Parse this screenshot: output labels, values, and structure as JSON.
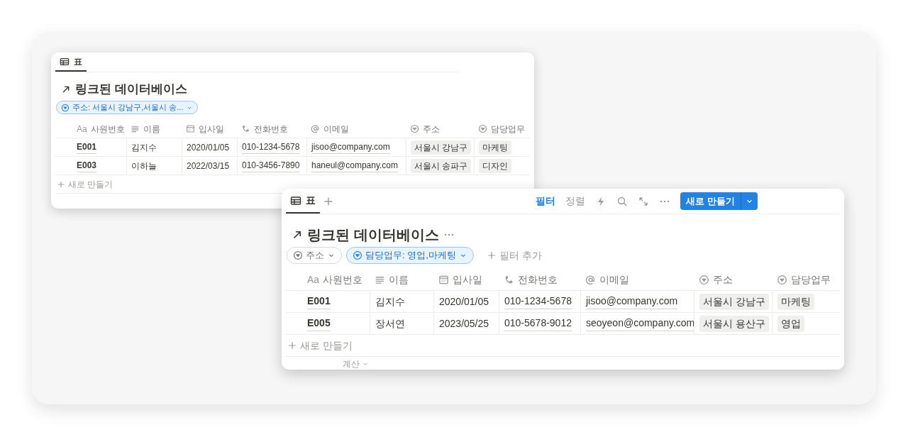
{
  "views": [
    {
      "tabs": [
        {
          "label": "표",
          "selected": true
        }
      ],
      "title": "링크된 데이터베이스",
      "filters": [
        {
          "label": "주소: 서울시 강남구,서울시 송...",
          "selected": true
        }
      ],
      "columns": [
        {
          "kind": "title",
          "icon_text": "Aa",
          "label": "사원번호"
        },
        {
          "kind": "text",
          "label": "이름"
        },
        {
          "kind": "date",
          "label": "입사일"
        },
        {
          "kind": "phone",
          "label": "전화번호"
        },
        {
          "kind": "email",
          "label": "이메일"
        },
        {
          "kind": "select",
          "label": "주소"
        },
        {
          "kind": "select",
          "label": "담당업무"
        }
      ],
      "rows": [
        [
          "E001",
          "김지수",
          "2020/01/05",
          "010-1234-5678",
          "jisoo@company.com",
          "서울시 강남구",
          "마케팅"
        ],
        [
          "E003",
          "이하늘",
          "2022/03/15",
          "010-3456-7890",
          "haneul@company.com",
          "서울시 송파구",
          "디자인"
        ]
      ],
      "new_row": "새로 만들기"
    },
    {
      "tabs": [
        {
          "label": "표",
          "selected": true
        }
      ],
      "add_tab": true,
      "title": "링크된 데이터베이스",
      "more_menu": true,
      "filters": [
        {
          "label": "주소",
          "selected": false
        },
        {
          "label": "담당업무: 영업,마케팅",
          "selected": true
        }
      ],
      "add_filter": "필터 추가",
      "toolbar": {
        "filter": {
          "label": "필터",
          "selected": true
        },
        "sort": {
          "label": "정렬",
          "selected": false
        },
        "new_button": "새로 만들기"
      },
      "columns": [
        {
          "kind": "title",
          "icon_text": "Aa",
          "label": "사원번호"
        },
        {
          "kind": "text",
          "label": "이름"
        },
        {
          "kind": "date",
          "label": "입사일"
        },
        {
          "kind": "phone",
          "label": "전화번호"
        },
        {
          "kind": "email",
          "label": "이메일"
        },
        {
          "kind": "select",
          "label": "주소"
        },
        {
          "kind": "select",
          "label": "담당업무"
        }
      ],
      "rows": [
        [
          "E001",
          "김지수",
          "2020/01/05",
          "010-1234-5678",
          "jisoo@company.com",
          "서울시 강남구",
          "마케팅"
        ],
        [
          "E005",
          "장서연",
          "2023/05/25",
          "010-5678-9012",
          "seoyeon@company.com",
          "서울시 용산구",
          "영업"
        ]
      ],
      "new_row": "새로 만들기",
      "footer": "계산"
    }
  ]
}
